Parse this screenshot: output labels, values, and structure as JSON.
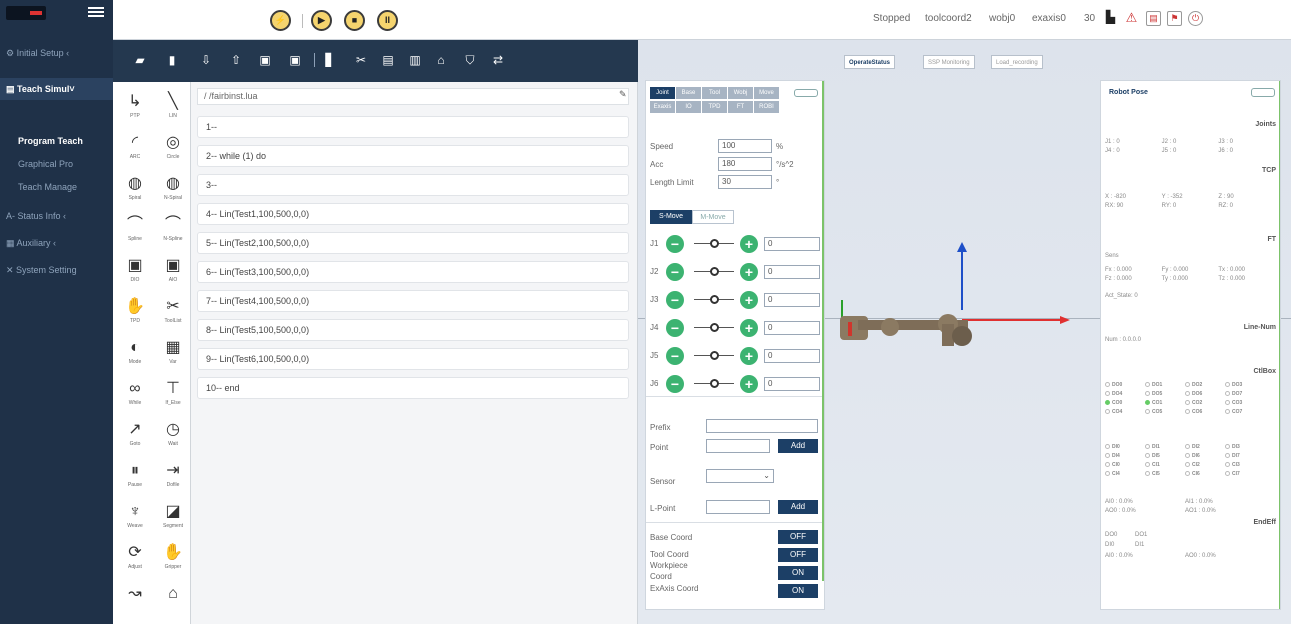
{
  "nav": {
    "items": [
      {
        "label": "Initial Setup  ‹"
      },
      {
        "label": "Teach Simul"
      },
      {
        "label": "Program Teach"
      },
      {
        "label": "Graphical Pro"
      },
      {
        "label": "Teach Manage"
      },
      {
        "label": "Status Info  ‹"
      },
      {
        "label": "Auxiliary  ‹"
      },
      {
        "label": "System Setting"
      }
    ]
  },
  "topbar": {
    "buttons": [
      "⚡",
      "▶",
      "■",
      "II"
    ],
    "status": "Stopped",
    "tool": "toolcoord2",
    "wobj": "wobj0",
    "exaxis": "exaxis0",
    "speed": "30"
  },
  "palette": [
    {
      "icon": "↳",
      "label": "PTP"
    },
    {
      "icon": "╲",
      "label": "LIN"
    },
    {
      "icon": "◜",
      "label": "ARC"
    },
    {
      "icon": "◎",
      "label": "Circle"
    },
    {
      "icon": "◍",
      "label": "Spiral"
    },
    {
      "icon": "◍",
      "label": "N-Spiral"
    },
    {
      "icon": "⌒",
      "label": "Spline"
    },
    {
      "icon": "⌒",
      "label": "N-Spline"
    },
    {
      "icon": "▣",
      "label": "DIO"
    },
    {
      "icon": "▣",
      "label": "AIO"
    },
    {
      "icon": "✋",
      "label": "TPD"
    },
    {
      "icon": "✂",
      "label": "ToolList"
    },
    {
      "icon": "◐",
      "label": "Mode"
    },
    {
      "icon": "▦",
      "label": "Var"
    },
    {
      "icon": "∞",
      "label": "While"
    },
    {
      "icon": "⊤",
      "label": "If_Else"
    },
    {
      "icon": "↗",
      "label": "Goto"
    },
    {
      "icon": "◷",
      "label": "Wait"
    },
    {
      "icon": "⏸",
      "label": "Pause"
    },
    {
      "icon": "⇥",
      "label": "Dofile"
    },
    {
      "icon": "♆",
      "label": "Weave"
    },
    {
      "icon": "◪",
      "label": "Segment"
    },
    {
      "icon": "⟳",
      "label": "Adjust"
    },
    {
      "icon": "✋",
      "label": "Gripper"
    },
    {
      "icon": "↝",
      "label": ""
    },
    {
      "icon": "⌂",
      "label": ""
    }
  ],
  "editor": {
    "file": "/ /fairbinst.lua",
    "lines": [
      "1--",
      "2-- while (1) do",
      "3--",
      "4-- Lin(Test1,100,500,0,0)",
      "5-- Lin(Test2,100,500,0,0)",
      "6-- Lin(Test3,100,500,0,0)",
      "7-- Lin(Test4,100,500,0,0)",
      "8-- Lin(Test5,100,500,0,0)",
      "9-- Lin(Test6,100,500,0,0)",
      "10-- end"
    ]
  },
  "jog": {
    "tabs_row1": [
      "Joint",
      "Base",
      "Tool",
      "Wobj",
      "Move"
    ],
    "tabs_row2": [
      "Exaxis",
      "IO",
      "TPD",
      "FT",
      "ROBI"
    ],
    "speed_label": "Speed",
    "speed_value": "100",
    "speed_unit": "%",
    "acc_label": "Acc",
    "acc_value": "180",
    "acc_unit": "°/s^2",
    "length_label": "Length  Limit",
    "length_value": "30",
    "length_unit": "°",
    "mode_on": "S-Move",
    "mode_off": "M-Move",
    "joints": [
      {
        "name": "J1",
        "value": "0"
      },
      {
        "name": "J2",
        "value": "0"
      },
      {
        "name": "J3",
        "value": "0"
      },
      {
        "name": "J4",
        "value": "0"
      },
      {
        "name": "J5",
        "value": "0"
      },
      {
        "name": "J6",
        "value": "0"
      }
    ],
    "prefix_label": "Prefix",
    "point_label": "Point",
    "add_label": "Add",
    "sensor_label": "Sensor",
    "lpoint_label": "L-Point",
    "base_coord_label": "Base   Coord",
    "tool_coord_label": "Tool   Coord",
    "workpiece_label": "Workpiece",
    "coord_label": "Coord",
    "exaxis_coord_label": "ExAxis Coord",
    "off": "OFF",
    "on": "ON"
  },
  "view": {
    "tabs": [
      "OperateStatus",
      "SSP Monitoring",
      "Load_recording"
    ]
  },
  "pose": {
    "title": "Robot Pose",
    "joints_header": "Joints",
    "joints": [
      "J1 : 0",
      "J2 : 0",
      "J3 : 0",
      "J4 : 0",
      "J5 : 0",
      "J6 : 0"
    ],
    "tcp_header": "TCP",
    "tcp": [
      "X : -820",
      "Y : -352",
      "Z : 90",
      "RX: 90",
      "RY: 0",
      "RZ: 0"
    ],
    "ft_header": "FT",
    "ft_sub": "Sens",
    "ft": [
      "Fx : 0.000",
      "Fy : 0.000",
      "Tx : 0.000",
      "Fz : 0.000",
      "Ty : 0.000",
      "Tz : 0.000"
    ],
    "act_state": "Act_State: 0",
    "linenum_header": "Line-Num",
    "num": "Num : 0.0.0.0",
    "ctlbox_header": "CtlBox",
    "do_rows": [
      [
        "DO0",
        "DO1",
        "DO2",
        "DO3"
      ],
      [
        "DO4",
        "DO5",
        "DO6",
        "DO7"
      ],
      [
        "CO0",
        "CO1",
        "CO2",
        "CO3"
      ],
      [
        "CO4",
        "CO5",
        "CO6",
        "CO7"
      ]
    ],
    "di_rows": [
      [
        "DI0",
        "DI1",
        "DI2",
        "DI3"
      ],
      [
        "DI4",
        "DI5",
        "DI6",
        "DI7"
      ],
      [
        "CI0",
        "CI1",
        "CI2",
        "CI3"
      ],
      [
        "CI4",
        "CI5",
        "CI6",
        "CI7"
      ]
    ],
    "ai": [
      "AI0 : 0.0%",
      "AI1 : 0.0%"
    ],
    "ao": [
      "AO0 : 0.0%",
      "AO1 : 0.0%"
    ],
    "endeff_header": "EndEff",
    "end_do": [
      "DO0",
      "DO1"
    ],
    "end_di": [
      "DI0",
      "DI1"
    ],
    "end_ai": "AI0 : 0.0%",
    "end_ao": "AO0 : 0.0%"
  }
}
